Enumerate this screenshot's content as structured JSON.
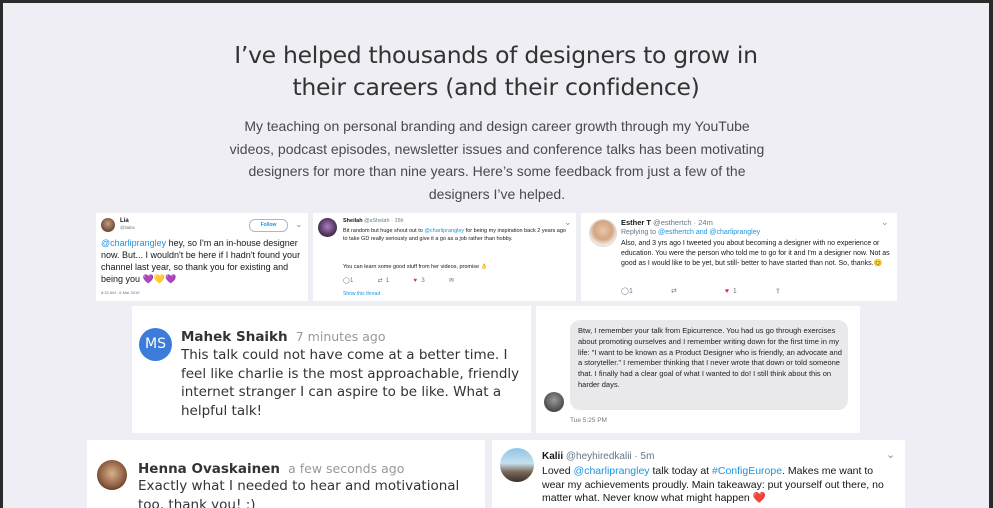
{
  "headline": {
    "line1": "I’ve helped thousands of designers to grow in",
    "line2": "their careers (and their confidence)"
  },
  "intro": "My teaching on personal branding and design career growth through my YouTube videos, podcast episodes, newsletter issues and conference talks has been motivating designers for more than nine years. Here’s some feedback from just a few of the designers I’ve helped.",
  "cards": {
    "lia": {
      "name": "Lia",
      "handle": "@lialex",
      "follow_label": "Follow",
      "mention": "@charliprangley",
      "text": " hey, so I'm an in-house designer now. But... I wouldn't be here if I hadn't found your channel last year, so thank you for existing and being you ",
      "hearts": "💜💛💜",
      "timestamp": "8:32 AM - 6 Mar 2019"
    },
    "sheilah": {
      "name": "Sheilah",
      "handle": "@sShelah · 15h",
      "text_before": "Bit random but huge shout out to ",
      "mention": "@charliprangley",
      "text_after": " for being my inspiration back 2 years ago to take GD really seriously and give it a go as a job rather than hobby.",
      "text2": "You can learn some good stuff from her videos, promise 👌",
      "reply_count": "1",
      "retweet_count": "1",
      "like_count": "3",
      "show_thread": "Show this thread"
    },
    "esther": {
      "name": "Esther T",
      "handle": "@esthertch · 24m",
      "reply_prefix": "Replying to ",
      "reply_to": "@esthertch and @charliprangley",
      "text": "Also, and 3 yrs ago I tweeted you about becoming a designer with no experience or education. You were the person who told me to go for it and I'm a designer now. Not as good as I would like to be yet, but still- better to have started than not. So, thanks.😊",
      "reply_count": "1",
      "like_count": "1"
    },
    "mahek": {
      "initials": "MS",
      "name": "Mahek Shaikh",
      "time": "7 minutes ago",
      "text": "This talk could not have come at a better time. I feel like charlie is the most approachable, friendly internet stranger I can aspire to be like. What a helpful talk!"
    },
    "dm": {
      "text": "Btw, I remember your talk from Epicurrence. You had us go through exercises about promoting ourselves and I remember writing down for the first time in my life: \"I want to be known as a Product Designer who is friendly, an advocate and a storyteller.\" I remember thinking that I never wrote that down or told someone that. I finally had a clear goal of what I wanted to do! I still think about this on harder days.",
      "time": "Tue 5:25 PM"
    },
    "henna": {
      "name": "Henna Ovaskainen",
      "time": "a few seconds ago",
      "text": "Exactly what I needed to hear and motivational too, thank you! :)"
    },
    "kalii": {
      "name": "Kalii",
      "handle": "@heyhiredkalii · 5m",
      "text_before": "Loved ",
      "mention": "@charliprangley",
      "text_mid": " talk today at ",
      "hashtag": "#ConfigEurope",
      "text_after": ". Makes me want to wear my achievements proudly. Main takeaway: put yourself out there, no matter what. Never know what might happen ",
      "emoji": "❤️"
    }
  },
  "colors": {
    "background": "#eeeef4",
    "link": "#1b95e0",
    "heart": "#e0245e",
    "ms_avatar": "#3b7bd9",
    "dm_bubble": "#e9e9eb"
  }
}
